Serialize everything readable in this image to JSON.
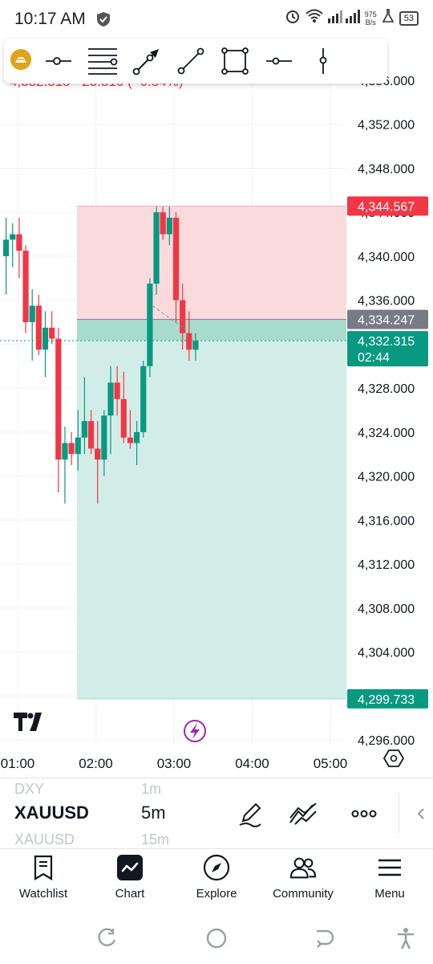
{
  "status_bar": {
    "time": "10:17 AM",
    "net_speed_value": "975",
    "net_speed_unit": "B/s",
    "battery": "53",
    "icons": [
      "shield-icon",
      "alarm-icon",
      "wifi-icon",
      "signal-icon",
      "lab-icon",
      "battery-icon"
    ]
  },
  "header": {
    "price_line": "4,332.315  −23.310 (−0.54%)"
  },
  "drawing_toolbar": {
    "tools": [
      "drag-handle-icon",
      "horizontal-ray-icon",
      "fib-retracement-icon",
      "arrow-line-icon",
      "trend-line-icon",
      "rectangle-icon",
      "horizontal-line-icon",
      "vertical-line-icon"
    ]
  },
  "chart_data": {
    "type": "candlestick",
    "symbol": "XAUUSD",
    "timeframe": "5m",
    "price_axis_ticks": [
      "4,356.000",
      "4,352.000",
      "4,348.000",
      "4,344.000",
      "4,340.000",
      "4,336.000",
      "4,332.000",
      "4,328.000",
      "4,324.000",
      "4,320.000",
      "4,316.000",
      "4,312.000",
      "4,308.000",
      "4,304.000",
      "4,300.000",
      "4,296.000"
    ],
    "time_axis_ticks": [
      "01:00",
      "02:00",
      "03:00",
      "04:00",
      "05:00"
    ],
    "ylim": [
      4295,
      4358
    ],
    "candles": [
      {
        "o": 4340.0,
        "h": 4343.5,
        "l": 4336.5,
        "c": 4341.5
      },
      {
        "o": 4341.5,
        "h": 4343.0,
        "l": 4339.0,
        "c": 4342.0
      },
      {
        "o": 4342.0,
        "h": 4343.5,
        "l": 4338.0,
        "c": 4340.5
      },
      {
        "o": 4340.5,
        "h": 4341.0,
        "l": 4333.0,
        "c": 4334.0
      },
      {
        "o": 4334.0,
        "h": 4337.0,
        "l": 4330.5,
        "c": 4335.5
      },
      {
        "o": 4335.5,
        "h": 4336.5,
        "l": 4331.0,
        "c": 4331.5
      },
      {
        "o": 4331.5,
        "h": 4335.0,
        "l": 4329.0,
        "c": 4333.5
      },
      {
        "o": 4333.5,
        "h": 4335.0,
        "l": 4332.0,
        "c": 4332.5
      },
      {
        "o": 4332.5,
        "h": 4333.5,
        "l": 4318.5,
        "c": 4321.5
      },
      {
        "o": 4321.5,
        "h": 4324.5,
        "l": 4317.5,
        "c": 4323.0
      },
      {
        "o": 4323.0,
        "h": 4324.0,
        "l": 4321.0,
        "c": 4322.0
      },
      {
        "o": 4322.0,
        "h": 4326.0,
        "l": 4320.5,
        "c": 4323.5
      },
      {
        "o": 4323.5,
        "h": 4329.0,
        "l": 4322.0,
        "c": 4325.0
      },
      {
        "o": 4325.0,
        "h": 4326.0,
        "l": 4322.0,
        "c": 4322.5
      },
      {
        "o": 4322.5,
        "h": 4325.0,
        "l": 4317.5,
        "c": 4321.5
      },
      {
        "o": 4321.5,
        "h": 4326.0,
        "l": 4320.0,
        "c": 4325.5
      },
      {
        "o": 4325.5,
        "h": 4330.0,
        "l": 4322.0,
        "c": 4328.5
      },
      {
        "o": 4328.5,
        "h": 4330.0,
        "l": 4325.5,
        "c": 4327.0
      },
      {
        "o": 4327.0,
        "h": 4329.5,
        "l": 4323.0,
        "c": 4323.5
      },
      {
        "o": 4323.5,
        "h": 4326.0,
        "l": 4322.5,
        "c": 4323.0
      },
      {
        "o": 4323.0,
        "h": 4325.0,
        "l": 4321.0,
        "c": 4324.0
      },
      {
        "o": 4324.0,
        "h": 4330.5,
        "l": 4323.5,
        "c": 4330.0
      },
      {
        "o": 4330.0,
        "h": 4338.0,
        "l": 4329.0,
        "c": 4337.5
      },
      {
        "o": 4337.5,
        "h": 4344.5,
        "l": 4336.5,
        "c": 4344.0
      },
      {
        "o": 4344.0,
        "h": 4344.5,
        "l": 4341.5,
        "c": 4342.0
      },
      {
        "o": 4342.0,
        "h": 4344.5,
        "l": 4341.0,
        "c": 4343.5
      },
      {
        "o": 4343.5,
        "h": 4344.0,
        "l": 4334.0,
        "c": 4336.0
      },
      {
        "o": 4336.0,
        "h": 4337.5,
        "l": 4331.5,
        "c": 4333.0
      },
      {
        "o": 4333.0,
        "h": 4335.0,
        "l": 4330.5,
        "c": 4331.5
      },
      {
        "o": 4331.5,
        "h": 4333.0,
        "l": 4330.5,
        "c": 4332.3
      }
    ],
    "position_tool": {
      "stop_price": "4,344.567",
      "entry_price": "4,334.247",
      "target_price": "4,299.733",
      "stop": 4344.567,
      "entry": 4334.247,
      "target": 4299.733
    },
    "last_price": "4,332.315",
    "last_price_value": 4332.315,
    "countdown": "02:44",
    "colors": {
      "up": "#089981",
      "down": "#f23645",
      "stop_zone": "#f9d6d9",
      "target_zone": "#d2ede7",
      "entry_tag": "#787b86"
    }
  },
  "symbol_bar": {
    "prev_symbol": "DXY",
    "symbol": "XAUUSD",
    "next_symbol": "XAUUSD",
    "prev_timeframe": "1m",
    "timeframe": "5m",
    "next_timeframe": "15m",
    "actions": [
      "pen-icon",
      "indicators-icon",
      "more-icon",
      "chevron-left-icon"
    ]
  },
  "bottom_nav": {
    "items": [
      {
        "label": "Watchlist",
        "icon": "watchlist-icon"
      },
      {
        "label": "Chart",
        "icon": "chart-icon"
      },
      {
        "label": "Explore",
        "icon": "compass-icon"
      },
      {
        "label": "Community",
        "icon": "community-icon"
      },
      {
        "label": "Menu",
        "icon": "menu-icon"
      }
    ]
  },
  "system_nav": {
    "buttons": [
      "recents-icon",
      "home-icon",
      "back-icon",
      "accessibility-icon"
    ]
  }
}
